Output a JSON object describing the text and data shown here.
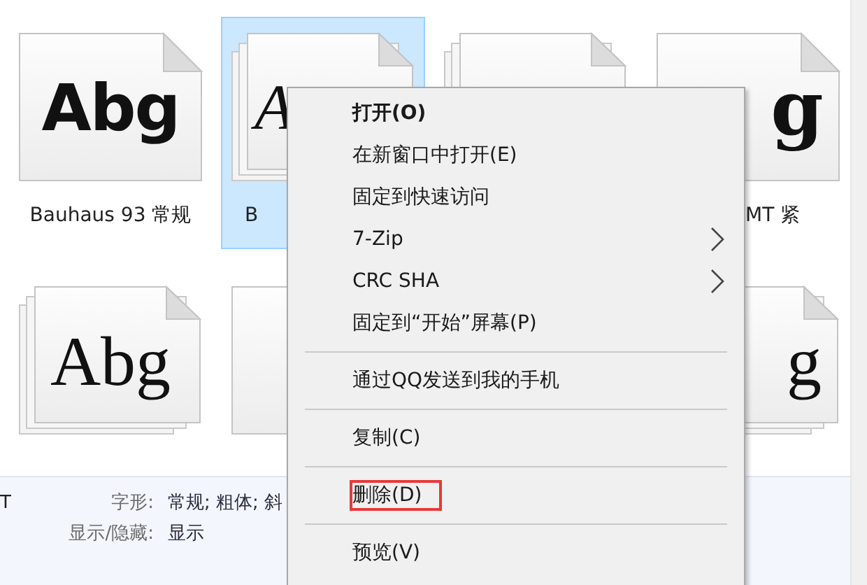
{
  "fonts": [
    {
      "kind": "geometric",
      "sample": "Abg",
      "stack": false,
      "selected": false,
      "label": "Bauhaus 93 常规"
    },
    {
      "kind": "italic",
      "sample": "A",
      "stack": true,
      "selected": true,
      "label": "B"
    },
    {
      "kind": "blank",
      "stack": true,
      "selected": false
    },
    {
      "kind": "heavy",
      "sample": "g",
      "stack": false,
      "selected": false,
      "label": "MT 紧"
    },
    {
      "kind": "serif",
      "sample": "Abg",
      "stack": true,
      "selected": false
    },
    {
      "kind": "blank",
      "stack": false,
      "selected": false
    },
    {
      "kind": "offset",
      "sample": "g",
      "stack": true,
      "selected": false
    }
  ],
  "details": {
    "name": "T",
    "fields": [
      {
        "label": "字形:",
        "value": "常规; 粗体; 斜"
      },
      {
        "label": "显示/隐藏:",
        "value": "显示"
      }
    ]
  },
  "context_menu": [
    {
      "kind": "item",
      "label": "打开(O)",
      "default": true,
      "marked": false
    },
    {
      "kind": "item",
      "label": "在新窗口中打开(E)",
      "default": false,
      "marked": false
    },
    {
      "kind": "item",
      "label": "固定到快速访问",
      "default": false,
      "marked": false
    },
    {
      "kind": "submenu",
      "label": "7-Zip",
      "default": false,
      "marked": false
    },
    {
      "kind": "submenu",
      "label": "CRC SHA",
      "default": false,
      "marked": false
    },
    {
      "kind": "item",
      "label": "固定到“开始”屏幕(P)",
      "default": false,
      "marked": false
    },
    {
      "kind": "separator"
    },
    {
      "kind": "item",
      "label": "通过QQ发送到我的手机",
      "default": false,
      "marked": false
    },
    {
      "kind": "separator"
    },
    {
      "kind": "item",
      "label": "复制(C)",
      "default": false,
      "marked": false
    },
    {
      "kind": "separator"
    },
    {
      "kind": "item",
      "label": "删除(D)",
      "default": false,
      "marked": true
    },
    {
      "kind": "separator"
    },
    {
      "kind": "item",
      "label": "预览(V)",
      "default": false,
      "marked": false
    }
  ]
}
